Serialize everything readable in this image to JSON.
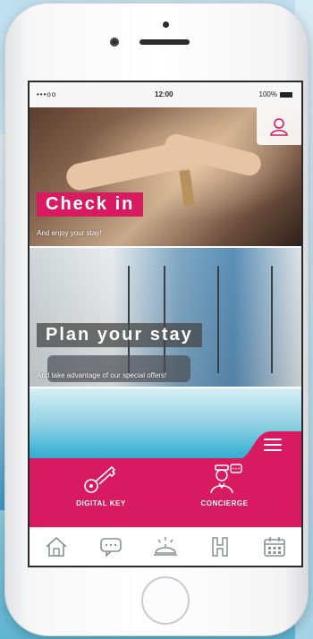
{
  "status_bar": {
    "carrier": "•••oo",
    "time": "12:00",
    "battery": "100%"
  },
  "panels": [
    {
      "title": "Check in",
      "subtitle": "And enjoy your stay!"
    },
    {
      "title": "Plan your stay",
      "subtitle": "And take advantage of our special offers!"
    }
  ],
  "menu": {
    "items": [
      {
        "label": "DIGITAL KEY",
        "icon": "key-icon"
      },
      {
        "label": "CONCIERGE",
        "icon": "concierge-icon"
      }
    ]
  },
  "tabbar": {
    "tabs": [
      {
        "icon": "home-icon"
      },
      {
        "icon": "chat-icon"
      },
      {
        "icon": "service-bell-icon"
      },
      {
        "icon": "hotel-icon"
      },
      {
        "icon": "calendar-icon"
      }
    ]
  },
  "colors": {
    "brand": "#d81b60",
    "tab_icon": "#8a8f97"
  }
}
